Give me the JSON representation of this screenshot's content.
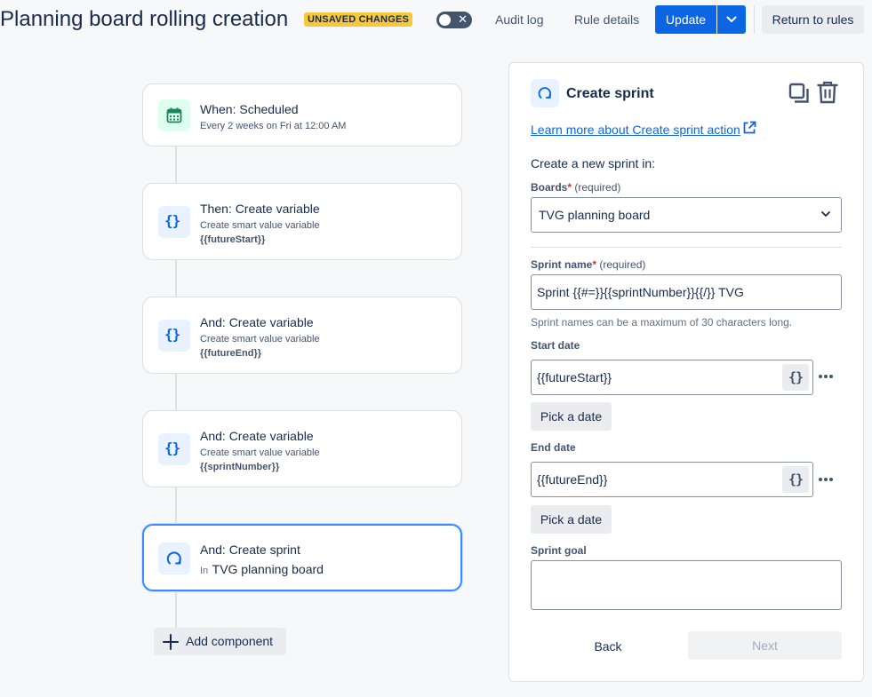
{
  "header": {
    "title": "Planning board rolling creation",
    "status_badge": "UNSAVED CHANGES",
    "toggle_state": "off",
    "audit_log": "Audit log",
    "rule_details": "Rule details",
    "update": "Update",
    "return_to_rules": "Return to rules"
  },
  "flow": {
    "trigger": {
      "title": "When: Scheduled",
      "subtitle": "Every 2 weeks on Fri at 12:00 AM",
      "icon": "calendar-icon"
    },
    "steps": [
      {
        "title": "Then: Create variable",
        "subtitle": "Create smart value variable",
        "variable": "{{futureStart}}",
        "icon": "braces-icon"
      },
      {
        "title": "And: Create variable",
        "subtitle": "Create smart value variable",
        "variable": "{{futureEnd}}",
        "icon": "braces-icon"
      },
      {
        "title": "And: Create variable",
        "subtitle": "Create smart value variable",
        "variable": "{{sprintNumber}}",
        "icon": "braces-icon"
      }
    ],
    "sprint_step": {
      "title": "And: Create sprint",
      "in_label": "In",
      "board": "TVG planning board",
      "icon": "sprint-icon"
    },
    "add_component": "Add component"
  },
  "panel": {
    "title": "Create sprint",
    "learn_more": "Learn more about Create sprint action",
    "intro": "Create a new sprint in:",
    "boards": {
      "label": "Boards",
      "required_mark": "*",
      "required_text": "(required)",
      "value": "TVG planning board"
    },
    "sprint_name": {
      "label": "Sprint name",
      "required_mark": "*",
      "required_text": "(required)",
      "value": "Sprint {{#=}}{{sprintNumber}}{{/}} TVG",
      "helper": "Sprint names can be a maximum of 30 characters long."
    },
    "start_date": {
      "label": "Start date",
      "value": "{{futureStart}}",
      "pick": "Pick a date"
    },
    "end_date": {
      "label": "End date",
      "value": "{{futureEnd}}",
      "pick": "Pick a date"
    },
    "sprint_goal": {
      "label": "Sprint goal",
      "value": ""
    },
    "back": "Back",
    "next": "Next"
  },
  "colors": {
    "primary": "#0c66e4",
    "badge": "#f8c83a",
    "selected_border": "#388bff",
    "trigger_icon_bg": "#dcfff1",
    "action_icon_bg": "#e9f2ff"
  }
}
